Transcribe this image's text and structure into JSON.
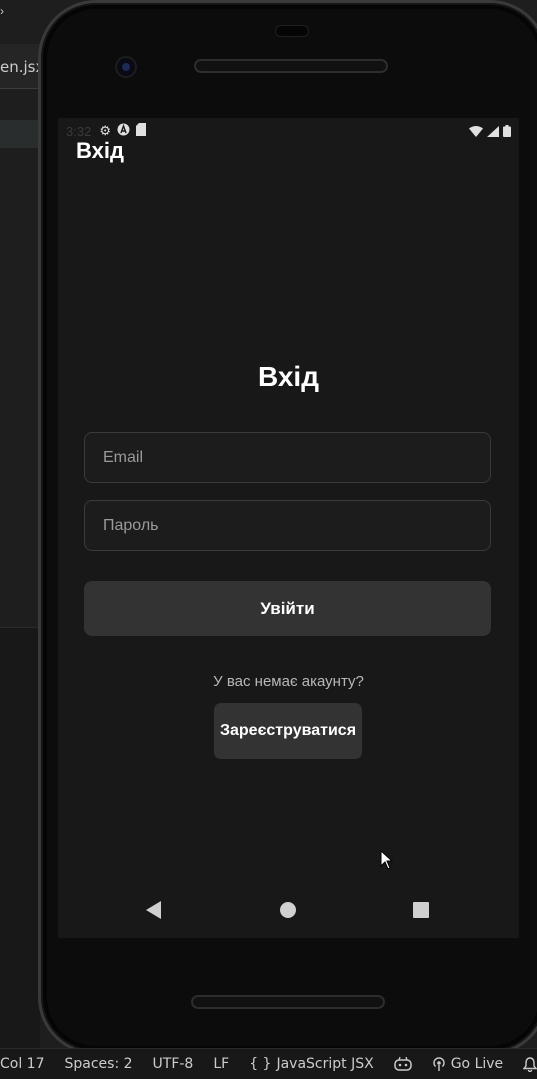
{
  "editor": {
    "tab_label": "en.jsx",
    "chevron": "›"
  },
  "statusbar": {
    "position": "Col 17",
    "spaces": "Spaces: 2",
    "encoding": "UTF-8",
    "eol": "LF",
    "language_icon": "{ }",
    "language": "JavaScript JSX",
    "copilot_icon": "copilot-icon",
    "golive_icon": "broadcast-icon",
    "golive": "Go Live",
    "bell_icon": "bell-icon"
  },
  "device_status": {
    "time": "3:32"
  },
  "app": {
    "header_title": "Вхід",
    "login_title": "Вхід",
    "email_placeholder": "Email",
    "password_placeholder": "Пароль",
    "login_button": "Увійти",
    "no_account_text": "У вас немає акаунту?",
    "register_button": "Зареєструватися"
  },
  "colors": {
    "screen_bg": "#181818",
    "button_bg": "#333333",
    "field_border": "#3a3a3a",
    "text_primary": "#ffffff",
    "text_secondary": "#b8b8b8"
  }
}
